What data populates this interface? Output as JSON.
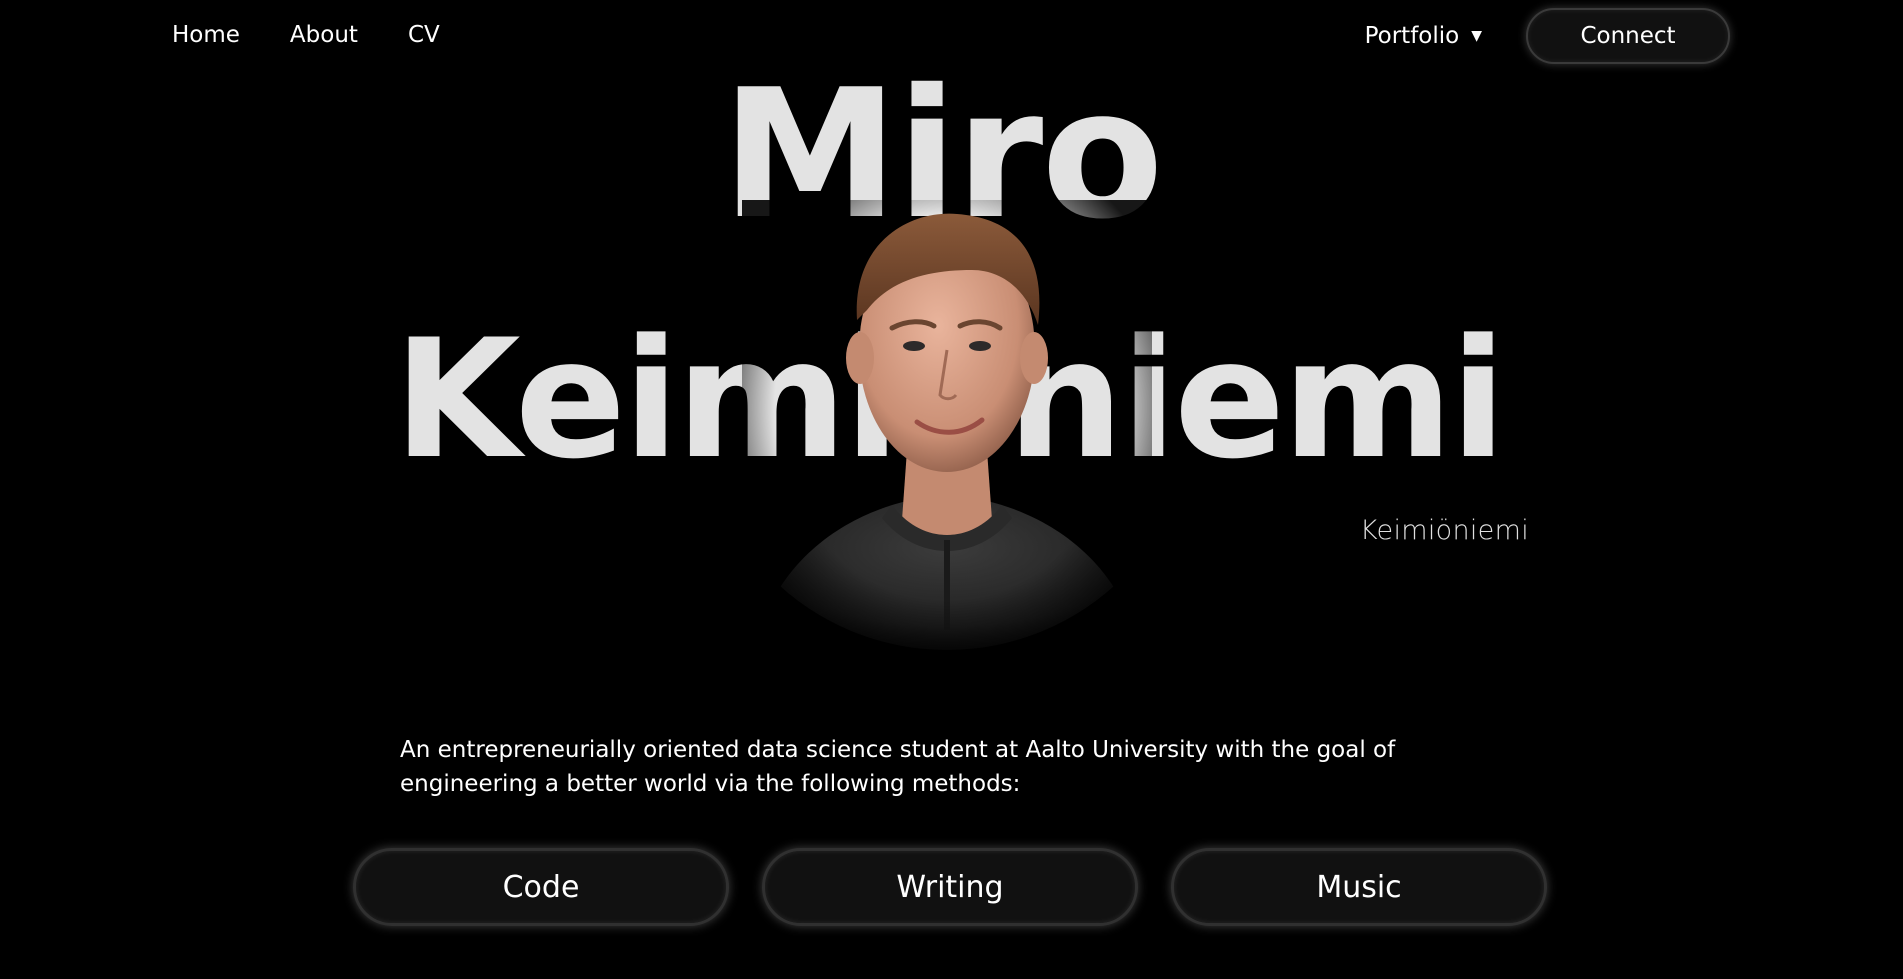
{
  "nav": {
    "links": [
      {
        "label": "Home"
      },
      {
        "label": "About"
      },
      {
        "label": "CV"
      }
    ],
    "portfolio_label": "Portfolio",
    "connect_label": "Connect"
  },
  "hero": {
    "first_name": "Miro",
    "last_name": "Keimiöniemi",
    "subtitle": "Keimiöniemi",
    "portrait_icon": "person-portrait"
  },
  "intro": {
    "text": "An entrepreneurially oriented data science student at Aalto University with the goal of engineering a better world via the following methods:"
  },
  "methods": [
    {
      "label": "Code"
    },
    {
      "label": "Writing"
    },
    {
      "label": "Music"
    }
  ],
  "colors": {
    "background": "#000000",
    "text": "#ffffff",
    "headline": "#e3e3e3",
    "button_fill": "#111111"
  }
}
